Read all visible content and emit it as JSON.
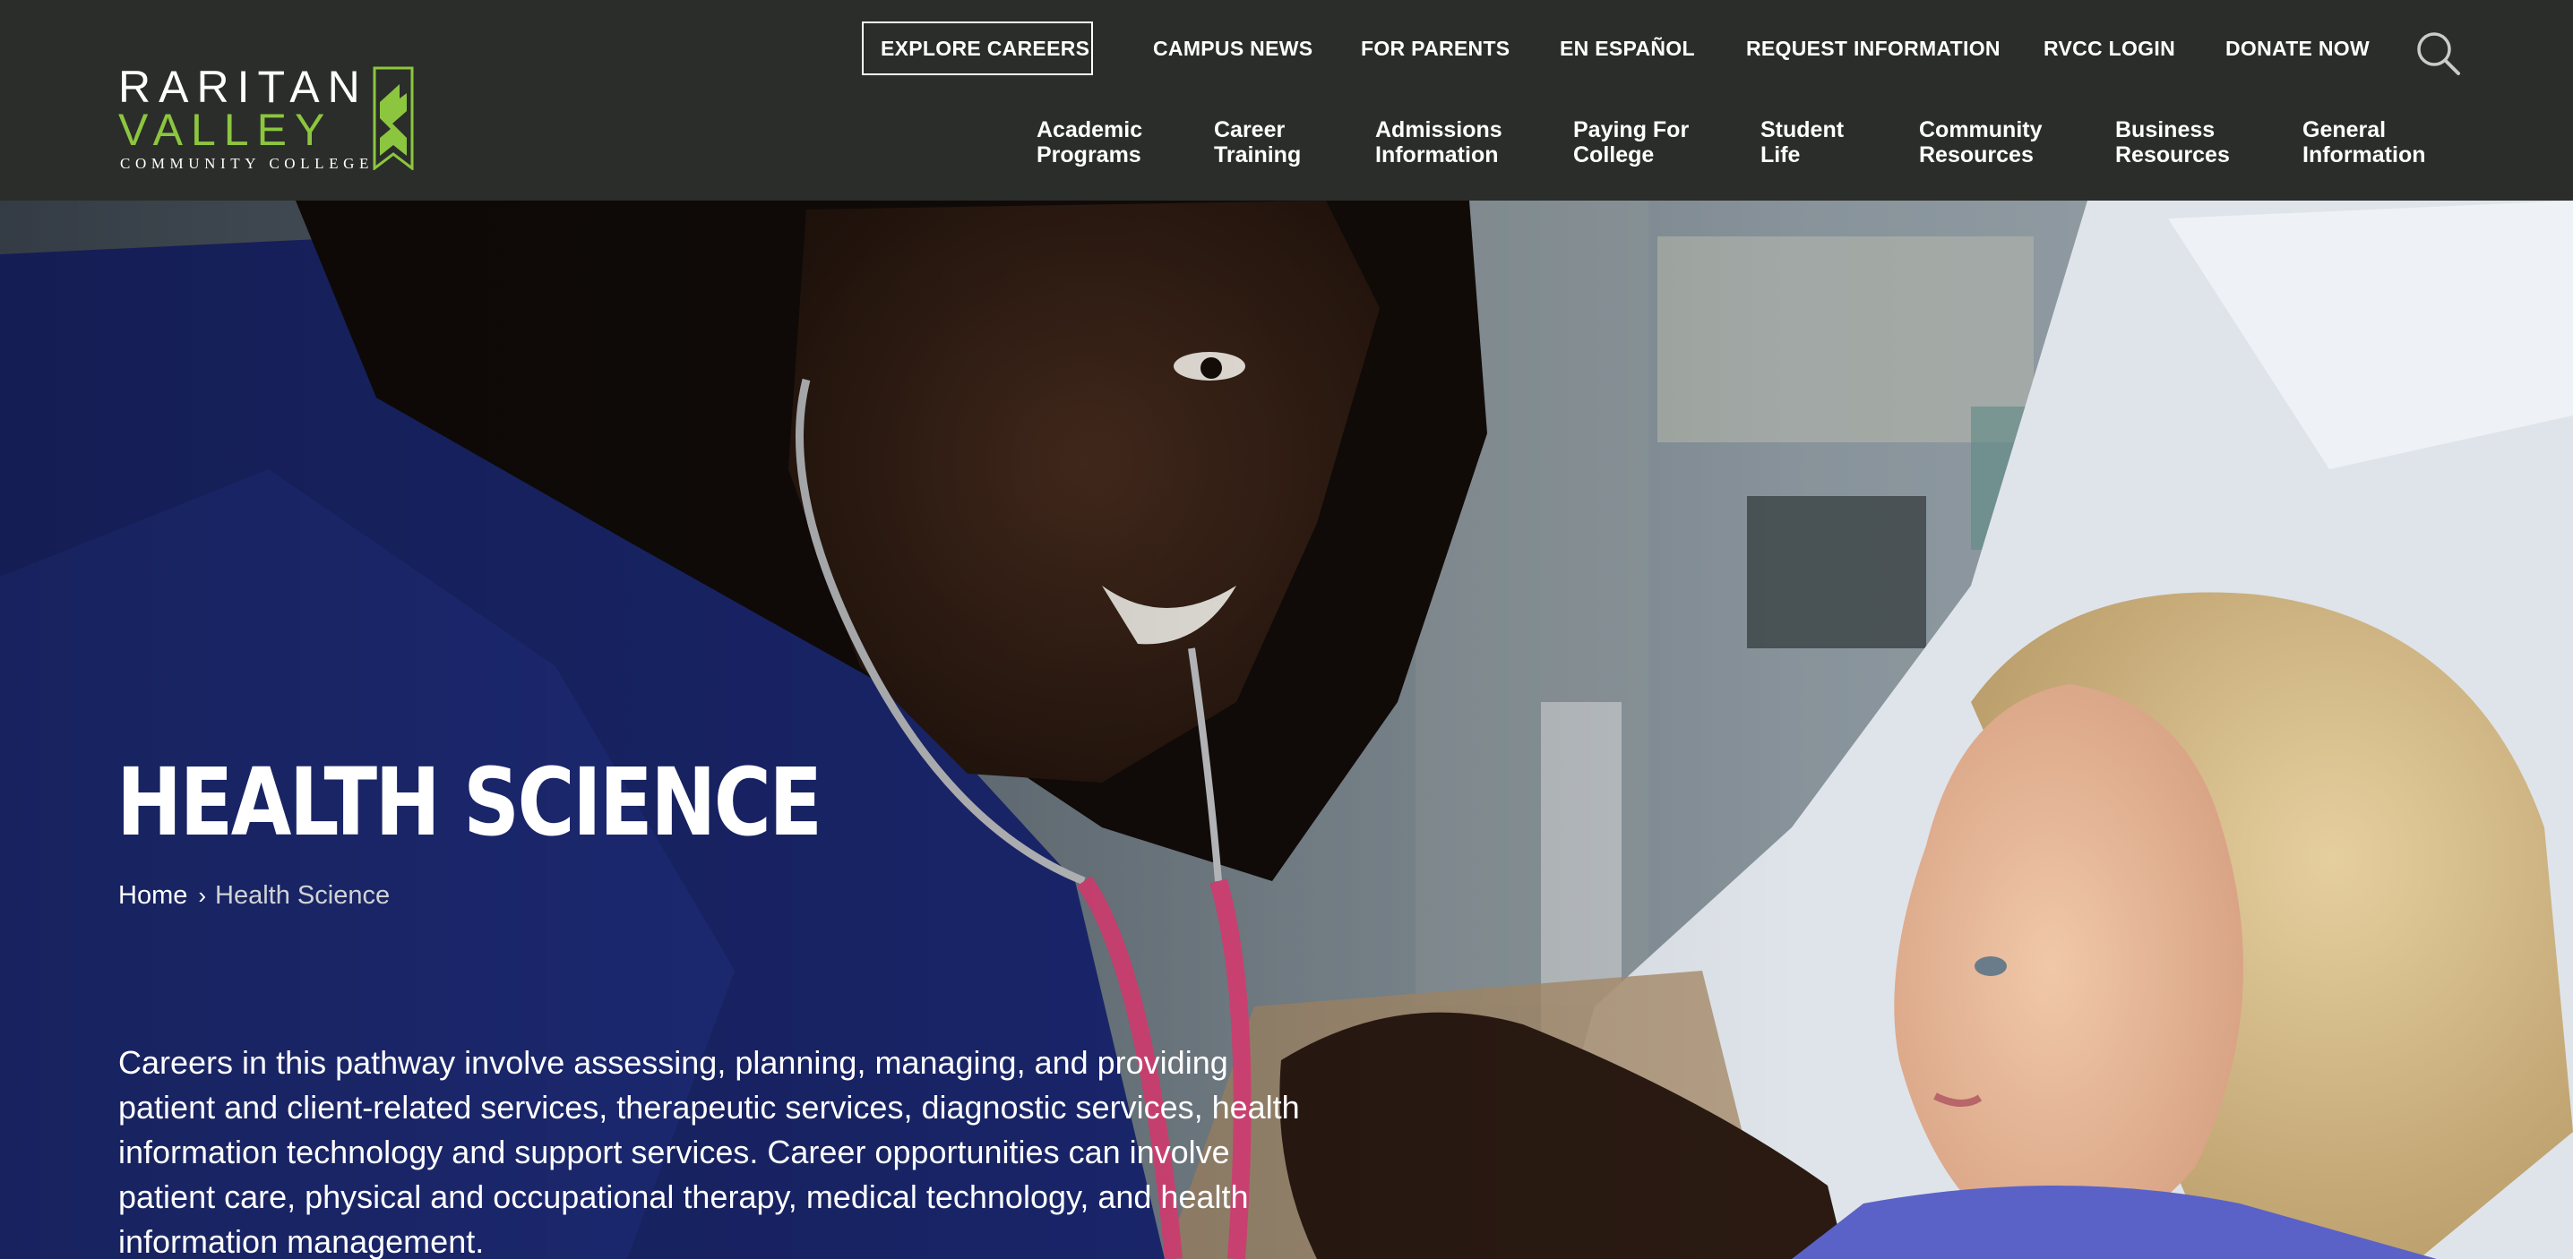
{
  "logo": {
    "line1": "RARITAN",
    "line2": "VALLEY",
    "line3": "COMMUNITY COLLEGE",
    "colors": {
      "white": "#ffffff",
      "green": "#8cc63f"
    }
  },
  "utility_nav": {
    "explore_careers": "EXPLORE CAREERS",
    "campus_news": "CAMPUS NEWS",
    "for_parents": "FOR PARENTS",
    "en_espanol": "EN ESPAÑOL",
    "request_information": "REQUEST INFORMATION",
    "rvcc_login": "RVCC LOGIN",
    "donate_now": "DONATE NOW",
    "search_icon": "search-icon"
  },
  "main_nav": [
    {
      "line1": "Academic",
      "line2": "Programs"
    },
    {
      "line1": "Career",
      "line2": "Training"
    },
    {
      "line1": "Admissions",
      "line2": "Information"
    },
    {
      "line1": "Paying For",
      "line2": "College"
    },
    {
      "line1": "Student",
      "line2": "Life"
    },
    {
      "line1": "Community",
      "line2": "Resources"
    },
    {
      "line1": "Business",
      "line2": "Resources"
    },
    {
      "line1": "General",
      "line2": "Information"
    }
  ],
  "hero": {
    "title": "HEALTH SCIENCE",
    "breadcrumb": {
      "home": "Home",
      "separator": "›",
      "current": "Health Science"
    },
    "intro": "Careers in this pathway involve assessing, planning, managing, and providing patient and client-related services, therapeutic services, diagnostic services, health information technology and support services. Career opportunities can involve patient care, physical and occupational therapy, medical technology, and health information management."
  },
  "colors": {
    "header_bg": "#2b2d2a",
    "accent_green": "#8cc63f",
    "text_white": "#ffffff"
  }
}
